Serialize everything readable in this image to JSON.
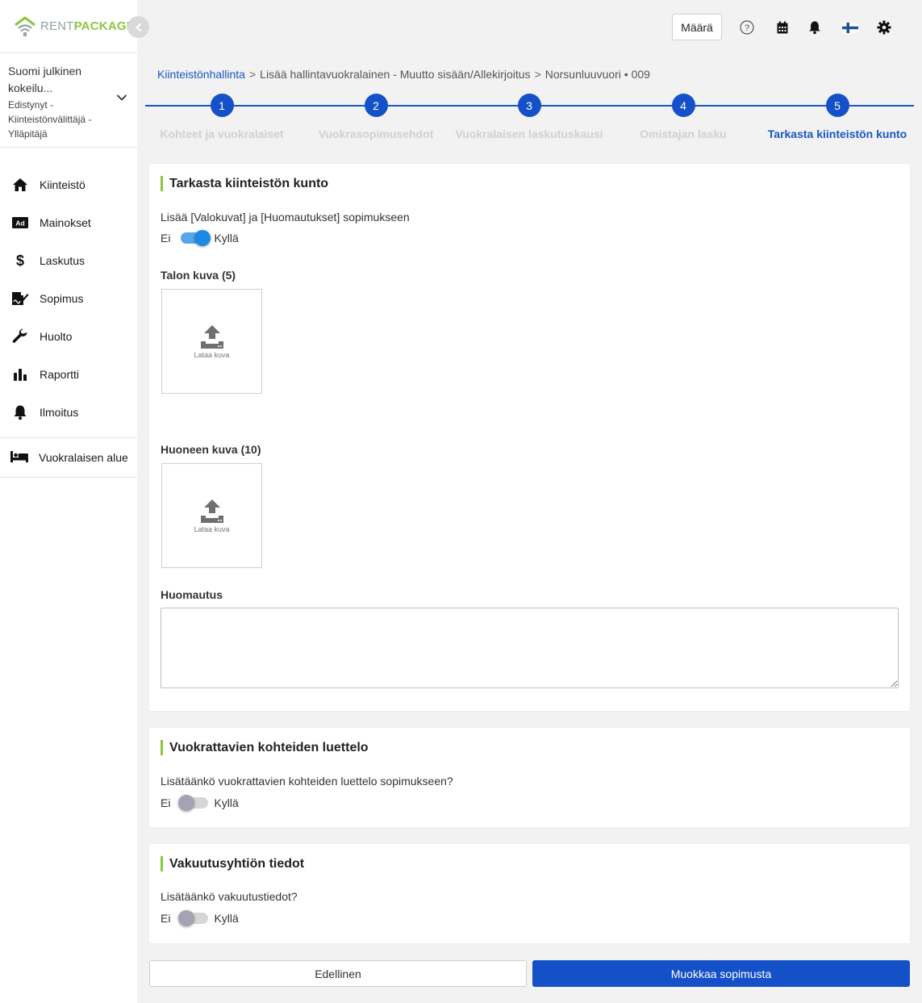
{
  "brand": {
    "logo_part1": "RENT",
    "logo_part2": "PACKAGE",
    "accent_green": "#8cc63f",
    "primary_blue": "#1451c9"
  },
  "account": {
    "name": "Suomi julkinen kokeilu...",
    "role": "Edistynyt - Kiinteistönvälittäjä - Ylläpitäjä"
  },
  "sidebar": {
    "items": [
      {
        "label": "Kiinteistö",
        "icon": "home-icon"
      },
      {
        "label": "Mainokset",
        "icon": "ad-icon"
      },
      {
        "label": "Laskutus",
        "icon": "dollar-icon"
      },
      {
        "label": "Sopimus",
        "icon": "contract-icon"
      },
      {
        "label": "Huolto",
        "icon": "wrench-icon"
      },
      {
        "label": "Raportti",
        "icon": "bar-chart-icon"
      },
      {
        "label": "Ilmoitus",
        "icon": "bell-icon"
      }
    ],
    "tenant_area": "Vuokralaisen alue"
  },
  "topbar": {
    "quantity_button": "Määrä"
  },
  "breadcrumb": {
    "root": "Kiinteistönhallinta",
    "middle": "Lisää hallintavuokralainen - Muutto sisään/Allekirjoitus",
    "last": "Norsunluuvuori • 009",
    "separator": ">"
  },
  "stepper": {
    "steps": [
      {
        "number": "1",
        "label": "Kohteet ja vuokralaiset"
      },
      {
        "number": "2",
        "label": "Vuokrasopimusehdot"
      },
      {
        "number": "3",
        "label": "Vuokralaisen laskutuskausi"
      },
      {
        "number": "4",
        "label": "Omistajan lasku"
      },
      {
        "number": "5",
        "label": "Tarkasta kiinteistön kunto"
      }
    ],
    "active_step": 5
  },
  "condition_card": {
    "title": "Tarkasta kiinteistön kunto",
    "question": "Lisää [Valokuvat] ja [Huomautukset] sopimukseen",
    "toggle_off_label": "Ei",
    "toggle_on_label": "Kyllä",
    "toggle_state": "on",
    "house_photo_label": "Talon kuva (5)",
    "room_photo_label": "Huoneen kuva (10)",
    "upload_label": "Lataa kuva",
    "note_label": "Huomautus",
    "note_value": ""
  },
  "inventory_card": {
    "title": "Vuokrattavien kohteiden luettelo",
    "question": "Lisätäänkö vuokrattavien kohteiden luettelo sopimukseen?",
    "toggle_off_label": "Ei",
    "toggle_on_label": "Kyllä",
    "toggle_state": "off"
  },
  "insurance_card": {
    "title": "Vakuutusyhtiön tiedot",
    "question": "Lisätäänkö vakuutustiedot?",
    "toggle_off_label": "Ei",
    "toggle_on_label": "Kyllä",
    "toggle_state": "off"
  },
  "actions": {
    "previous": "Edellinen",
    "edit_contract": "Muokkaa sopimusta"
  }
}
